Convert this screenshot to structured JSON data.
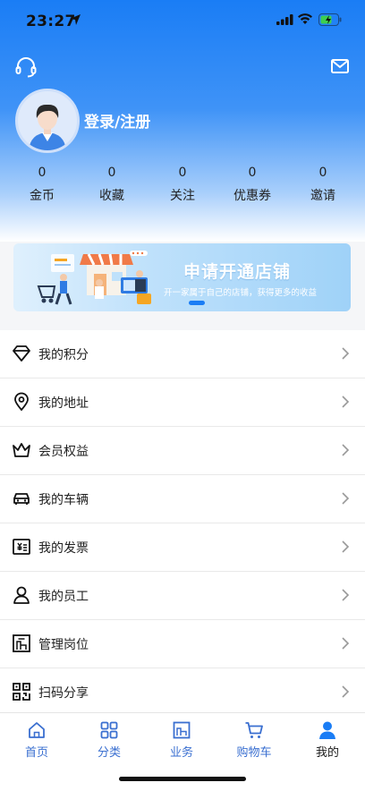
{
  "status_bar": {
    "time": "23:27"
  },
  "header": {
    "login_text": "登录/注册",
    "icons": {
      "left": "headset-icon",
      "right": "mail-icon"
    }
  },
  "stats": [
    {
      "value": "0",
      "label": "金币"
    },
    {
      "value": "0",
      "label": "收藏"
    },
    {
      "value": "0",
      "label": "关注"
    },
    {
      "value": "0",
      "label": "优惠券"
    },
    {
      "value": "0",
      "label": "邀请"
    }
  ],
  "banner": {
    "title": "申请开通店铺",
    "subtitle": "开一家属于自己的店铺，获得更多的收益"
  },
  "menu": [
    {
      "label": "我的积分",
      "icon": "diamond-icon"
    },
    {
      "label": "我的地址",
      "icon": "location-pin-icon"
    },
    {
      "label": "会员权益",
      "icon": "crown-icon"
    },
    {
      "label": "我的车辆",
      "icon": "car-icon"
    },
    {
      "label": "我的发票",
      "icon": "invoice-icon"
    },
    {
      "label": "我的员工",
      "icon": "person-icon"
    },
    {
      "label": "管理岗位",
      "icon": "building-icon"
    },
    {
      "label": "扫码分享",
      "icon": "qr-code-icon"
    }
  ],
  "tabbar": [
    {
      "label": "首页",
      "icon": "home-icon"
    },
    {
      "label": "分类",
      "icon": "grid-icon"
    },
    {
      "label": "业务",
      "icon": "business-icon"
    },
    {
      "label": "购物车",
      "icon": "cart-icon"
    },
    {
      "label": "我的",
      "icon": "user-icon",
      "active": true
    }
  ],
  "colors": {
    "accent": "#1a7df5",
    "tab_text": "#3a6fd0"
  }
}
